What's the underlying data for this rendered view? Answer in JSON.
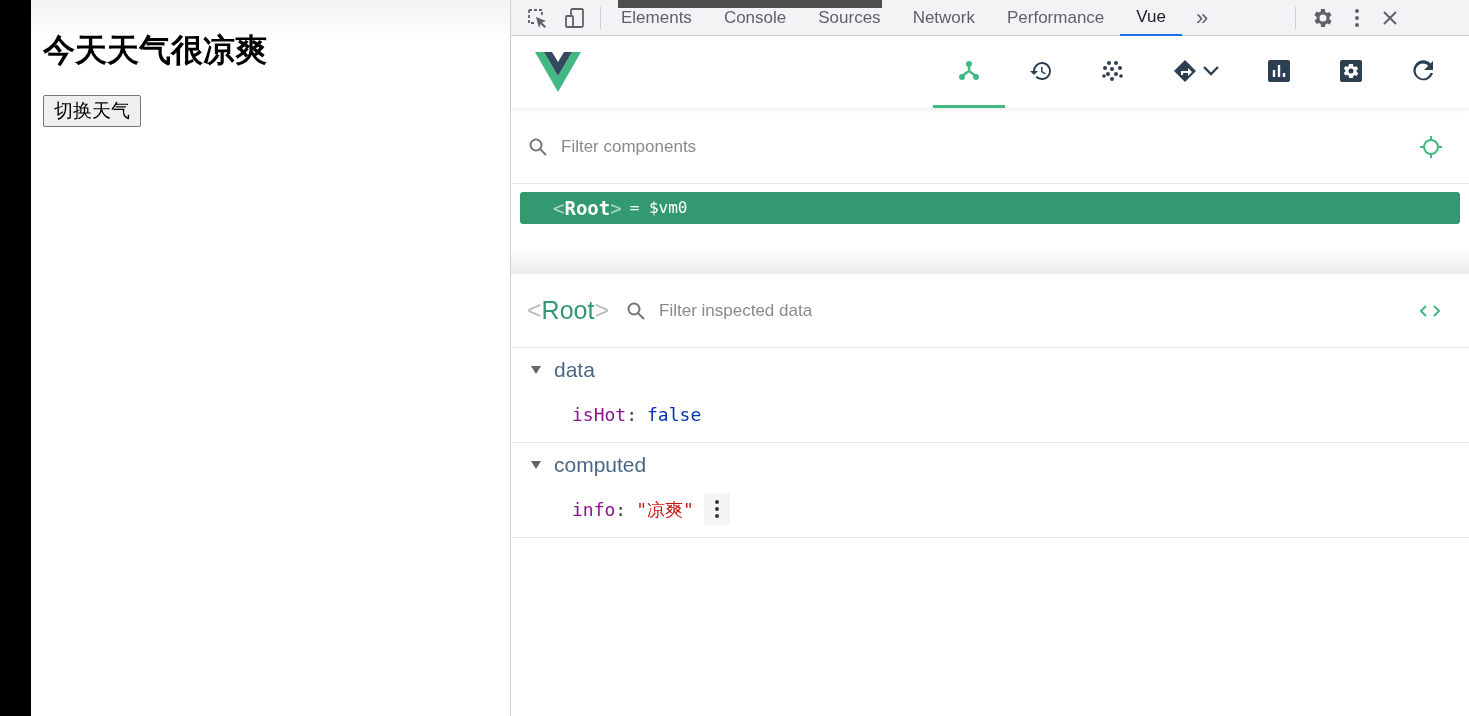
{
  "page": {
    "heading": "今天天气很凉爽",
    "button": "切换天气"
  },
  "devtools_tabs": [
    {
      "label": "Elements",
      "selected": false
    },
    {
      "label": "Console",
      "selected": false
    },
    {
      "label": "Sources",
      "selected": false
    },
    {
      "label": "Network",
      "selected": false
    },
    {
      "label": "Performance",
      "selected": false
    },
    {
      "label": "Vue",
      "selected": true
    }
  ],
  "more_tabs": "»",
  "vue_toolbar": [
    {
      "kind": "components",
      "selected": true
    },
    {
      "kind": "history",
      "selected": false
    },
    {
      "kind": "vuex",
      "selected": false
    },
    {
      "kind": "router",
      "selected": false
    },
    {
      "kind": "performance",
      "selected": false
    },
    {
      "kind": "settings",
      "selected": false
    },
    {
      "kind": "refresh",
      "selected": false
    }
  ],
  "component_filter": {
    "placeholder": "Filter components"
  },
  "tree": [
    {
      "open": "<",
      "name": "Root",
      "close": ">",
      "assign": "= $vm0",
      "selected": true
    }
  ],
  "inspector": {
    "open": "<",
    "name": "Root",
    "close": ">",
    "placeholder": "Filter inspected data",
    "sections": [
      {
        "title": "data",
        "expanded": true,
        "props": [
          {
            "key": "isHot",
            "separator": ":",
            "value": "false",
            "kind": "boolean"
          }
        ]
      },
      {
        "title": "computed",
        "expanded": true,
        "props": [
          {
            "key": "info",
            "separator": ":",
            "value": "\"凉爽\"",
            "kind": "string"
          }
        ]
      }
    ]
  }
}
